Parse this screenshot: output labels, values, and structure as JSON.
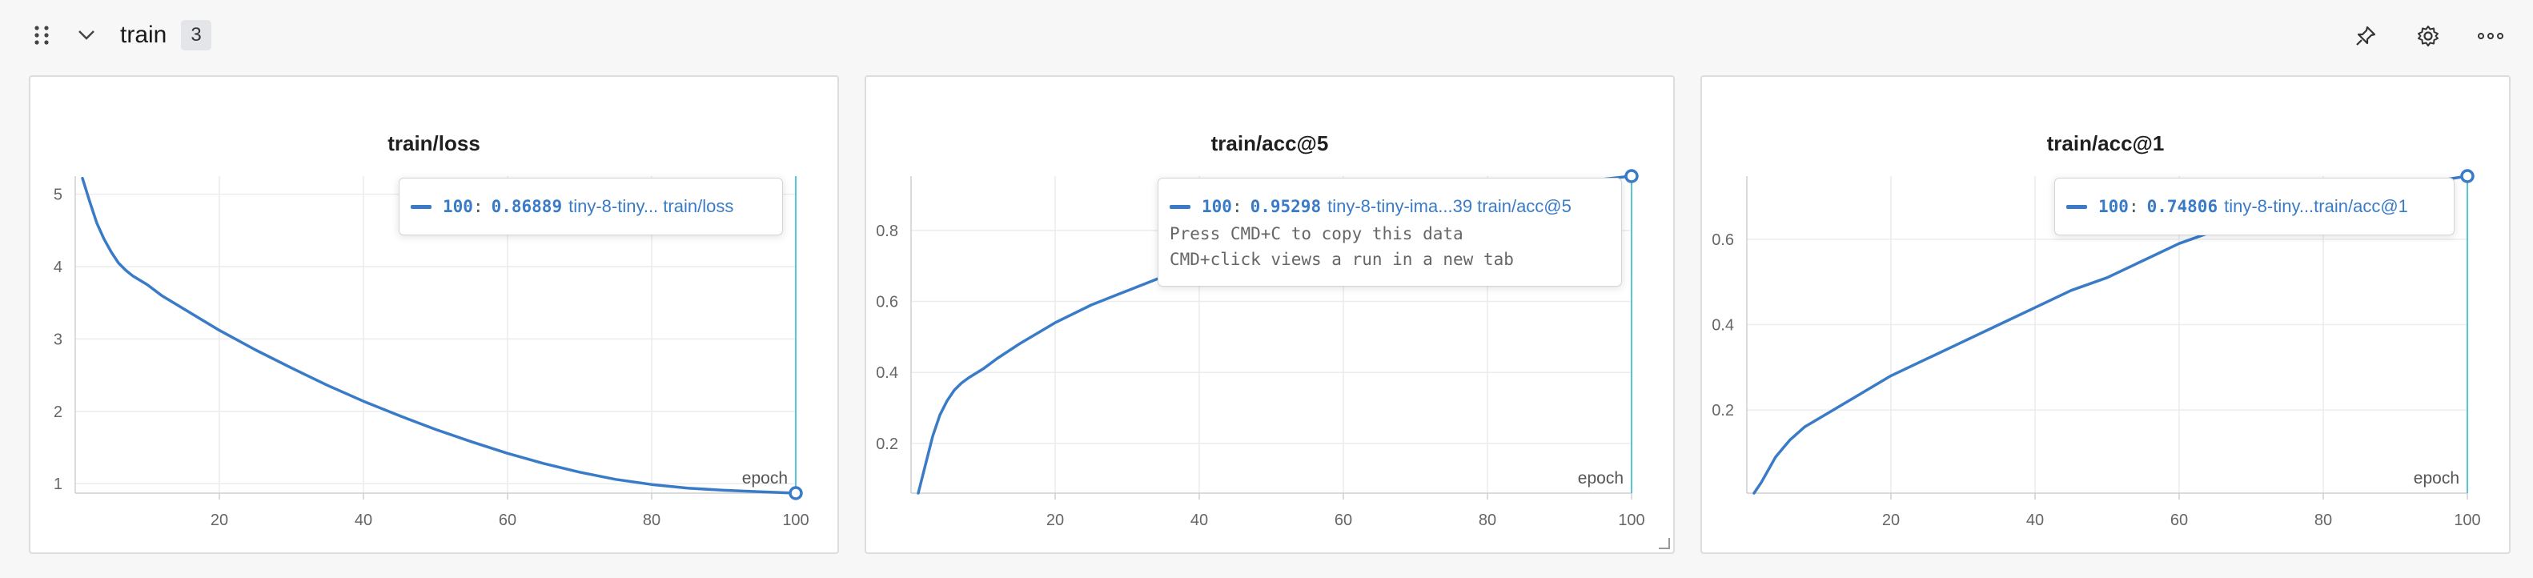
{
  "section": {
    "title": "train",
    "count": "3",
    "icons": {
      "drag": "drag-handle-icon",
      "collapse": "chevron-down-icon",
      "pin": "pin-icon",
      "settings": "gear-icon",
      "more": "more-icon"
    }
  },
  "colors": {
    "series": "#3a7bc8",
    "crosshair": "#57c6d9",
    "grid": "#ececec",
    "axis": "#cfcfcf"
  },
  "panels": [
    {
      "title": "train/loss",
      "tooltip": {
        "step": "100",
        "value": "0.86889",
        "run": "tiny-8-tiny... train/loss",
        "hints": []
      },
      "chart_data": {
        "type": "line",
        "title": "train/loss",
        "xlabel": "epoch",
        "ylabel": "",
        "xlim": [
          0,
          100
        ],
        "ylim": [
          0.87,
          5.25
        ],
        "xticks": [
          20,
          40,
          60,
          80,
          100
        ],
        "yticks": [
          1,
          2,
          3,
          4,
          5
        ],
        "grid": true,
        "series": [
          {
            "x": [
              1,
              2,
              3,
              4,
              5,
              6,
              7,
              8,
              10,
              12,
              15,
              20,
              25,
              30,
              35,
              40,
              45,
              50,
              55,
              60,
              65,
              70,
              75,
              80,
              85,
              90,
              95,
              100
            ],
            "values": [
              5.22,
              4.9,
              4.6,
              4.38,
              4.2,
              4.05,
              3.95,
              3.87,
              3.75,
              3.6,
              3.42,
              3.12,
              2.85,
              2.6,
              2.36,
              2.14,
              1.94,
              1.75,
              1.58,
              1.42,
              1.28,
              1.16,
              1.06,
              0.99,
              0.94,
              0.91,
              0.89,
              0.87
            ]
          }
        ],
        "hover_x": 100
      }
    },
    {
      "title": "train/acc@5",
      "tooltip": {
        "step": "100",
        "value": "0.95298",
        "run": "tiny-8-tiny-ima...39 train/acc@5",
        "hints": [
          "Press CMD+C to copy this data",
          "CMD+click views a run in a new tab"
        ]
      },
      "chart_data": {
        "type": "line",
        "title": "train/acc@5",
        "xlabel": "epoch",
        "ylabel": "",
        "xlim": [
          0,
          100
        ],
        "ylim": [
          0.06,
          0.953
        ],
        "xticks": [
          20,
          40,
          60,
          80,
          100
        ],
        "yticks": [
          0.2,
          0.4,
          0.6,
          0.8
        ],
        "grid": true,
        "series": [
          {
            "x": [
              1,
              2,
              3,
              4,
              5,
              6,
              7,
              8,
              10,
              12,
              15,
              20,
              25,
              30,
              35,
              40,
              45,
              50,
              55,
              60,
              65,
              70,
              75,
              80,
              85,
              90,
              95,
              100
            ],
            "values": [
              0.06,
              0.14,
              0.22,
              0.28,
              0.32,
              0.35,
              0.37,
              0.385,
              0.41,
              0.44,
              0.48,
              0.54,
              0.59,
              0.63,
              0.67,
              0.7,
              0.73,
              0.76,
              0.79,
              0.81,
              0.84,
              0.86,
              0.88,
              0.9,
              0.915,
              0.93,
              0.942,
              0.953
            ]
          }
        ],
        "hover_x": 100
      }
    },
    {
      "title": "train/acc@1",
      "tooltip": {
        "step": "100",
        "value": "0.74806",
        "run": "tiny-8-tiny...train/acc@1",
        "hints": []
      },
      "chart_data": {
        "type": "line",
        "title": "train/acc@1",
        "xlabel": "epoch",
        "ylabel": "",
        "xlim": [
          0,
          100
        ],
        "ylim": [
          0.005,
          0.748
        ],
        "xticks": [
          20,
          40,
          60,
          80,
          100
        ],
        "yticks": [
          0.2,
          0.4,
          0.6
        ],
        "grid": true,
        "series": [
          {
            "x": [
              1,
              2,
              3,
              4,
              5,
              6,
              7,
              8,
              10,
              12,
              15,
              20,
              25,
              30,
              35,
              40,
              45,
              50,
              55,
              60,
              65,
              70,
              75,
              80,
              85,
              90,
              95,
              100
            ],
            "values": [
              0.005,
              0.03,
              0.06,
              0.09,
              0.11,
              0.13,
              0.145,
              0.16,
              0.18,
              0.2,
              0.23,
              0.28,
              0.32,
              0.36,
              0.4,
              0.44,
              0.48,
              0.51,
              0.55,
              0.59,
              0.62,
              0.64,
              0.66,
              0.68,
              0.7,
              0.72,
              0.735,
              0.748
            ]
          }
        ],
        "hover_x": 100
      }
    }
  ]
}
